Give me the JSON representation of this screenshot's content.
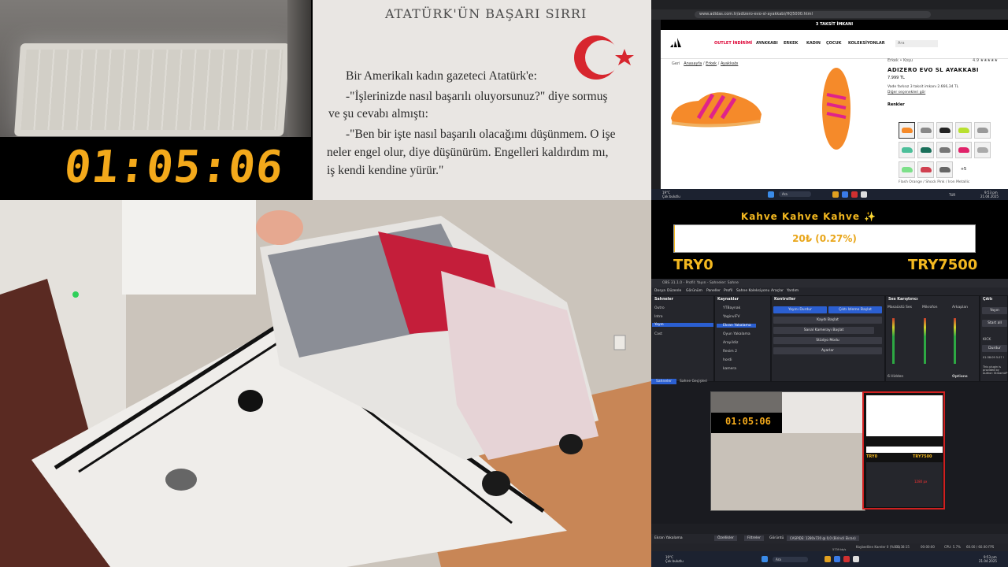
{
  "timer": {
    "value": "01:05:06"
  },
  "book": {
    "title": "ATATÜRK'ÜN BAŞARI SIRRI",
    "lines": [
      "Bir Amerikalı kadın gazeteci Atatürk'e:",
      "-\"İşlerinizde nasıl başarılı oluyorsunuz?\" diye sormuş",
      "ve şu cevabı almıştı:",
      "-\"Ben bir işte nasıl başarılı olacağımı düşünmem. O işe",
      "neler engel olur, diye düşünürüm. Engelleri kaldırdım mı,",
      "iş kendi kendine yürür.\""
    ]
  },
  "browser": {
    "url": "www.adidas.com.tr/adizero-evo-sl-ayakkabi/HQ5000.html",
    "promo": "3 TAKSİT İMKANI",
    "nav": [
      "OUTLET İNDİRİMİ",
      "AYAKKABI",
      "ERKEK",
      "KADIN",
      "ÇOCUK",
      "KOLEKSİYONLAR"
    ],
    "search_placeholder": "Ara",
    "breadcrumb": [
      "Geri",
      "Anasayfa",
      "Erkek",
      "Ayakkabı"
    ],
    "product": {
      "category": "Erkek • Koşu",
      "rating": "4.9 ★★★★★",
      "name": "ADIZERO EVO SL AYAKKABI",
      "price": "7.999 TL",
      "installment": "Vade farksız 3 taksit imkanı 2.666,34 TL",
      "other_options": "Diğer seçenekleri gör",
      "colors_label": "Renkler",
      "more_colors": "+5",
      "color_name": "Flash Orange / Shock Pink / Iron Metallic"
    },
    "taskbar": {
      "weather": "19°C",
      "weather_sub": "Çok bulutlu",
      "search": "Ara",
      "lang": "TUR",
      "time": "9:53 pm",
      "date": "21.04.2025"
    },
    "colors": {
      "orange": "#f58a2a",
      "pink": "#e0238a"
    }
  },
  "kahve": {
    "title": "Kahve Kahve Kahve ✨",
    "progress_text": "20₺ (0.27%)",
    "progress_fraction": 0.0027,
    "min": "TRY0",
    "max": "TRY7500"
  },
  "obs": {
    "title": "OBS 31.1.0 - Profil: Yayın - Sahneler: Sahne",
    "menu": [
      "Dosya",
      "Düzenle",
      "Görünüm",
      "Paneller",
      "Profil",
      "Sahne Koleksiyonu",
      "Araçlar",
      "Yardım"
    ],
    "scenes_header": "Sahneler",
    "scenes": [
      "Outro",
      "Intro",
      "Yayın",
      "Cast"
    ],
    "sources_header": "Kaynaklar",
    "sources": [
      "YTBaynak",
      "YaginviFV",
      "Ekran Yakalama",
      "Oyun Yakalama",
      "Arayildiz",
      "Resim 2",
      "hordi",
      "kamera"
    ],
    "controls_header": "Kontroller",
    "controls": [
      "Yayını Durdur",
      "Çıktı Izleme Başlat",
      "Kaydı Başlat",
      "Sanal Kamerayı Başlat",
      "Stüdyo Modu",
      "Ayarlar"
    ],
    "mixer_header": "Ses Karıştırıcı",
    "mixer_channels": [
      "Masaüstü Ses",
      "Mikrofon",
      "Arkaplan"
    ],
    "mixer_footer": "Options",
    "hidden_label": "6 Hidden",
    "stream_header": "Çıktı",
    "stream_items": [
      "Yayın",
      "Start all",
      "KICK",
      "Durdur",
      "01:38:09  5.07 !"
    ],
    "stream_note": "This plugin is provided by Author: StreamUP",
    "scenes_tab": "Sahneler",
    "transitions_tab": "Sahne Geçişleri",
    "source_selected": "Ekran Yakalama",
    "properties_btn": "Özellikler",
    "filters_btn": "Filtreler",
    "display_label": "Görüntü",
    "display_value": "CASPIDE: 1280x720 @ 0,0 (Birincil Ekran)",
    "status": {
      "dropped": "Kaybedilen Kareler 0 (%0.0)",
      "live": "01:38:15",
      "rec": "00:00:00",
      "cpu": "CPU: 5.7%",
      "fps": "60.00 / 60.00 FPS",
      "bitrate": "5739 kb/s"
    },
    "taskbar": {
      "weather": "19°C",
      "weather_sub": "Çok bulutlu",
      "search": "Ara",
      "time": "9:53 pm",
      "date": "21.04.2025"
    },
    "thumb_timer": "01:05:06",
    "thumb_min": "TRY0",
    "thumb_max": "TRY7500",
    "thumb_size": "1280 px"
  }
}
